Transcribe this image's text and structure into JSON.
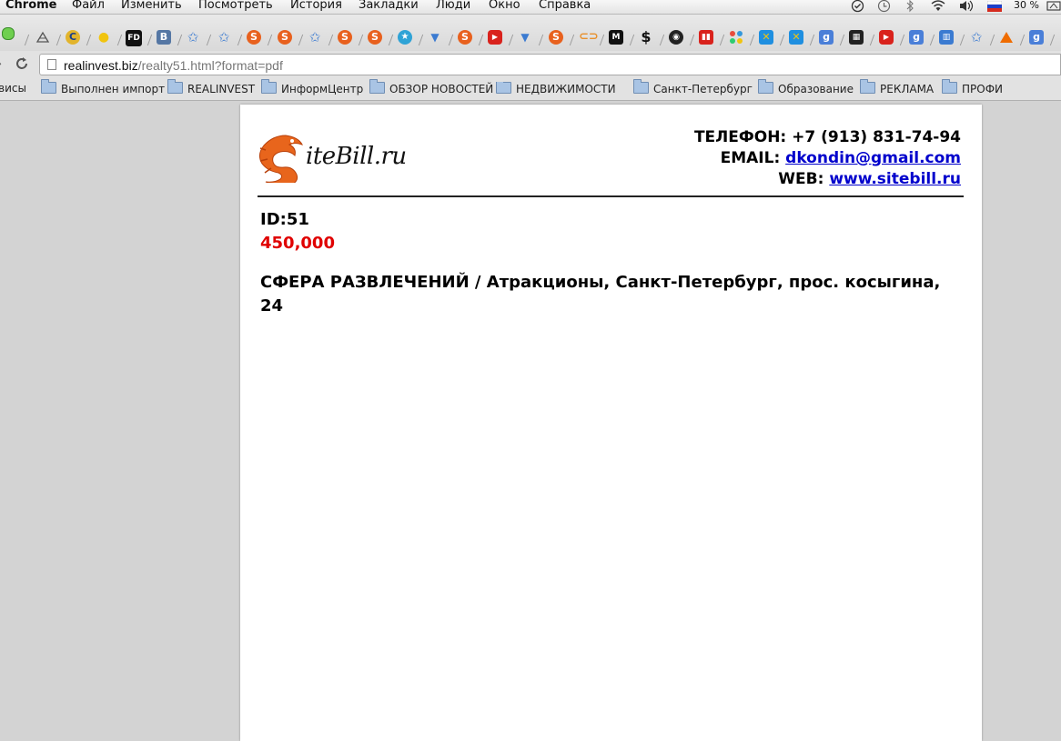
{
  "menubar": {
    "app": "Chrome",
    "items": [
      "Файл",
      "Изменить",
      "Посмотреть",
      "История",
      "Закладки",
      "Люди",
      "Окно",
      "Справка"
    ],
    "battery": "30 %"
  },
  "toolbar": {
    "icons": [
      "ruler-icon",
      "c-icon",
      "duck-icon",
      "fd-icon",
      "vk-icon",
      "star-icon",
      "star-icon",
      "s-icon",
      "s-icon",
      "star-icon",
      "s-icon",
      "s-icon",
      "star-icon",
      "m-icon",
      "s-icon",
      "youtube-icon",
      "m-icon",
      "s-icon",
      "link-icon",
      "m-black-icon",
      "dollar-icon",
      "eye-icon",
      "chart-icon",
      "dots-icon",
      "x-icon",
      "x-icon",
      "g-icon",
      "clapper-icon",
      "youtube-icon",
      "g-icon",
      "building-icon",
      "star-icon",
      "triangle-icon",
      "g-icon"
    ]
  },
  "address": {
    "domain": "realinvest.biz",
    "path": "/realty51.html?format=pdf"
  },
  "bookmarks": {
    "cut_item": "висы",
    "items": [
      "Выполнен импорт",
      "REALINVEST",
      "ИнформЦентр",
      "ОБЗОР НОВОСТЕЙ",
      "НЕДВИЖИМОСТИ К",
      "Санкт-Петербург",
      "Образование",
      "РЕКЛАМА",
      "ПРОФИ"
    ]
  },
  "page": {
    "logo_text": "iteBill.ru",
    "phone": "ТЕЛЕФОН: +7 (913) 831-74-94",
    "email_label": "EMAIL: ",
    "email": "dkondin@gmail.com",
    "web_label": "WEB: ",
    "web": "www.sitebill.ru",
    "id": "ID:51",
    "price": "450,000",
    "description": "СФЕРА РАЗВЛЕЧЕНИЙ / Атракционы, Санкт-Петербург, прос. косыгина, 24"
  },
  "colors": {
    "price": "#e00000",
    "link": "#0000cc",
    "logo_accent": "#e8651c"
  }
}
